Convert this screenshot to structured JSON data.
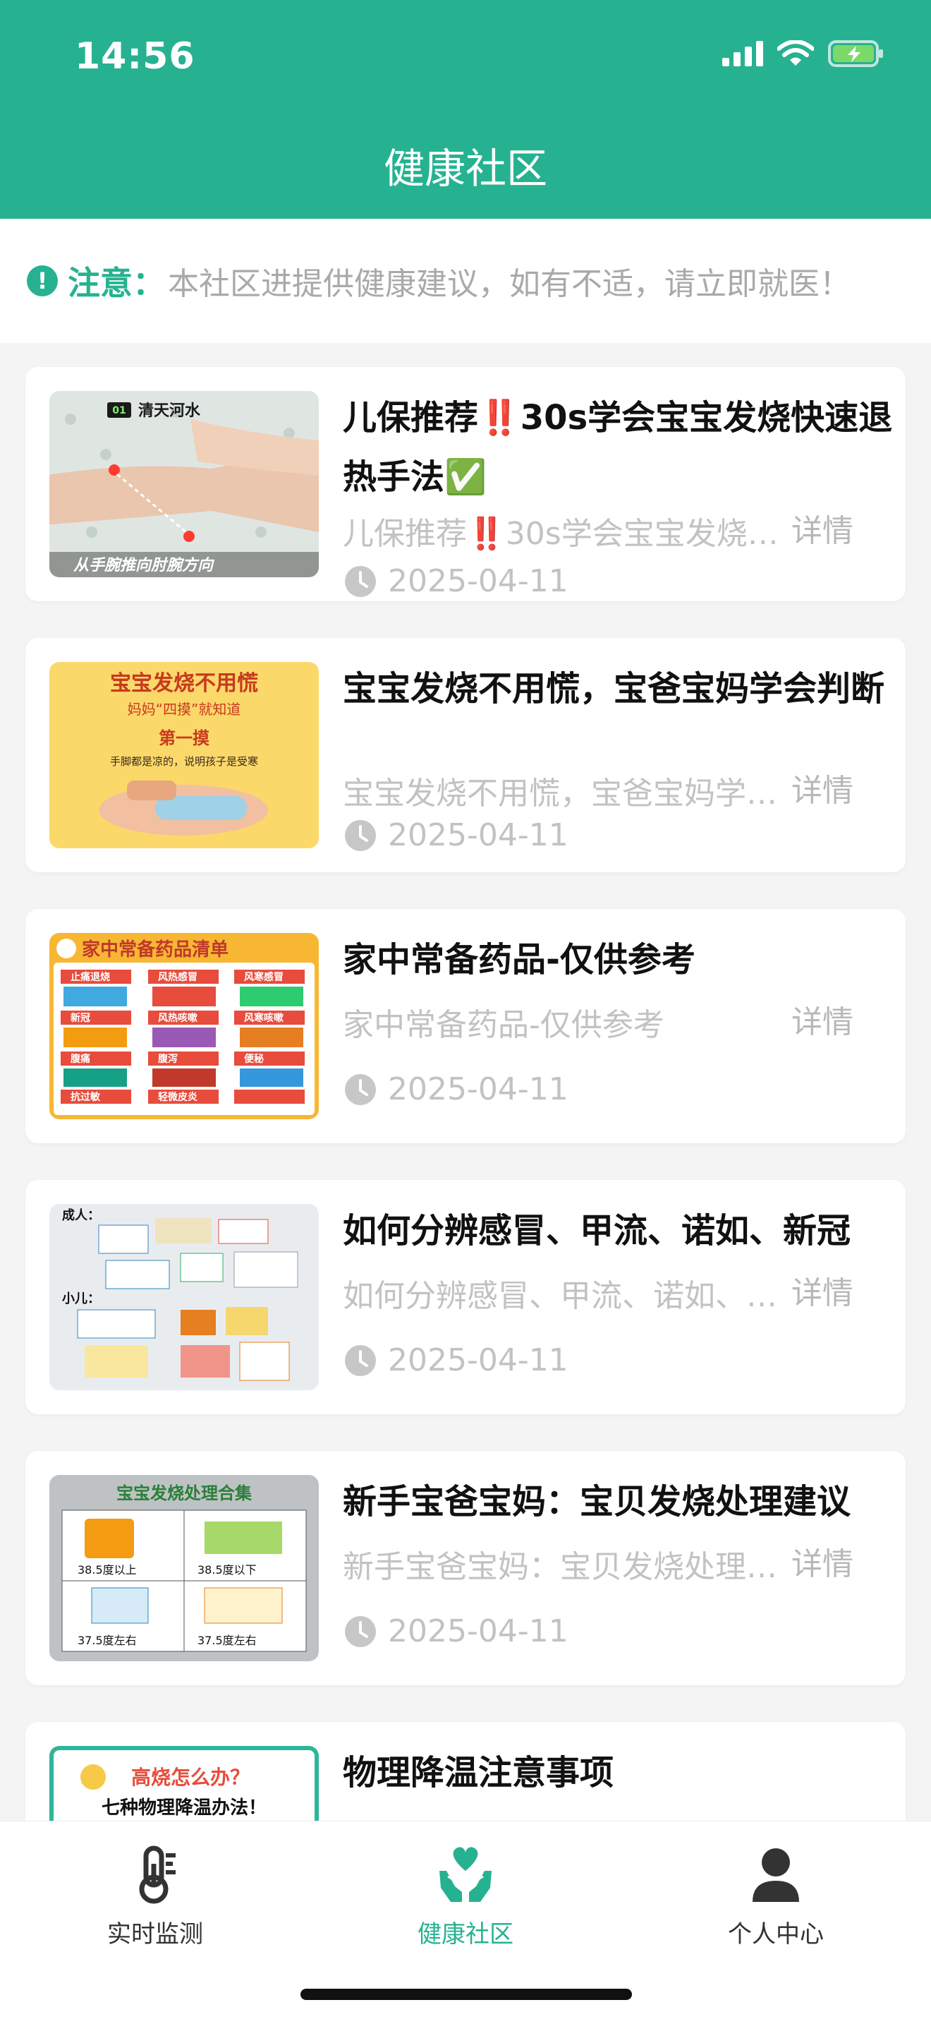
{
  "status_bar": {
    "time": "14:56"
  },
  "header": {
    "title": "健康社区"
  },
  "notice": {
    "label": "注意：",
    "text": "本社区进提供健康建议，如有不适，请立即就医！"
  },
  "articles": [
    {
      "title": "儿保推荐‼️30s学会宝宝发烧快速退热手法✅",
      "summary": "儿保推荐‼️30s学会宝宝发烧快速退热手法✅",
      "detail": "详情",
      "date": "2025-04-11",
      "thumb_text": [
        "01",
        "清天河水",
        "从手腕推向肘腕方向"
      ]
    },
    {
      "title": "宝宝发烧不用慌，宝爸宝妈学会判断",
      "summary": "宝宝发烧不用慌，宝爸宝妈学会判断",
      "detail": "详情",
      "date": "2025-04-11",
      "thumb_text": [
        "宝宝发烧不用慌",
        "妈妈“四摸”就知道",
        "第一摸",
        "手脚都是凉的，说明孩子是受寒"
      ]
    },
    {
      "title": "家中常备药品-仅供参考",
      "summary": "家中常备药品-仅供参考",
      "detail": "详情",
      "date": "2025-04-11",
      "thumb_text": [
        "家中常备药品清单",
        "止痛退烧",
        "风热感冒",
        "风寒感冒",
        "新冠",
        "风热咳嗽",
        "风寒咳嗽",
        "腹痛",
        "腹泻",
        "便秘",
        "抗过敏",
        "轻微皮炎"
      ]
    },
    {
      "title": "如何分辨感冒、甲流、诺如、新冠",
      "summary": "如何分辨感冒、甲流、诺如、新冠",
      "detail": "详情",
      "date": "2025-04-11",
      "thumb_text": [
        "成人：",
        "小儿："
      ]
    },
    {
      "title": "新手宝爸宝妈：宝贝发烧处理建议",
      "summary": "新手宝爸宝妈：宝贝发烧处理建议",
      "detail": "详情",
      "date": "2025-04-11",
      "thumb_text": [
        "宝宝发烧处理合集",
        "38.5度以上",
        "38.5度以下",
        "37.5度左右",
        "37.5度左右"
      ]
    },
    {
      "title": "物理降温注意事项",
      "summary": "",
      "detail": "",
      "date": "",
      "thumb_text": [
        "高烧怎么办？",
        "七种物理降温办法！"
      ]
    }
  ],
  "tabbar": {
    "tabs": [
      {
        "label": "实时监测",
        "icon": "thermometer-icon",
        "active": false
      },
      {
        "label": "健康社区",
        "icon": "heart-hands-icon",
        "active": true
      },
      {
        "label": "个人中心",
        "icon": "person-icon",
        "active": false
      }
    ]
  },
  "colors": {
    "brand": "#26b291",
    "muted": "#c2c2c2"
  }
}
